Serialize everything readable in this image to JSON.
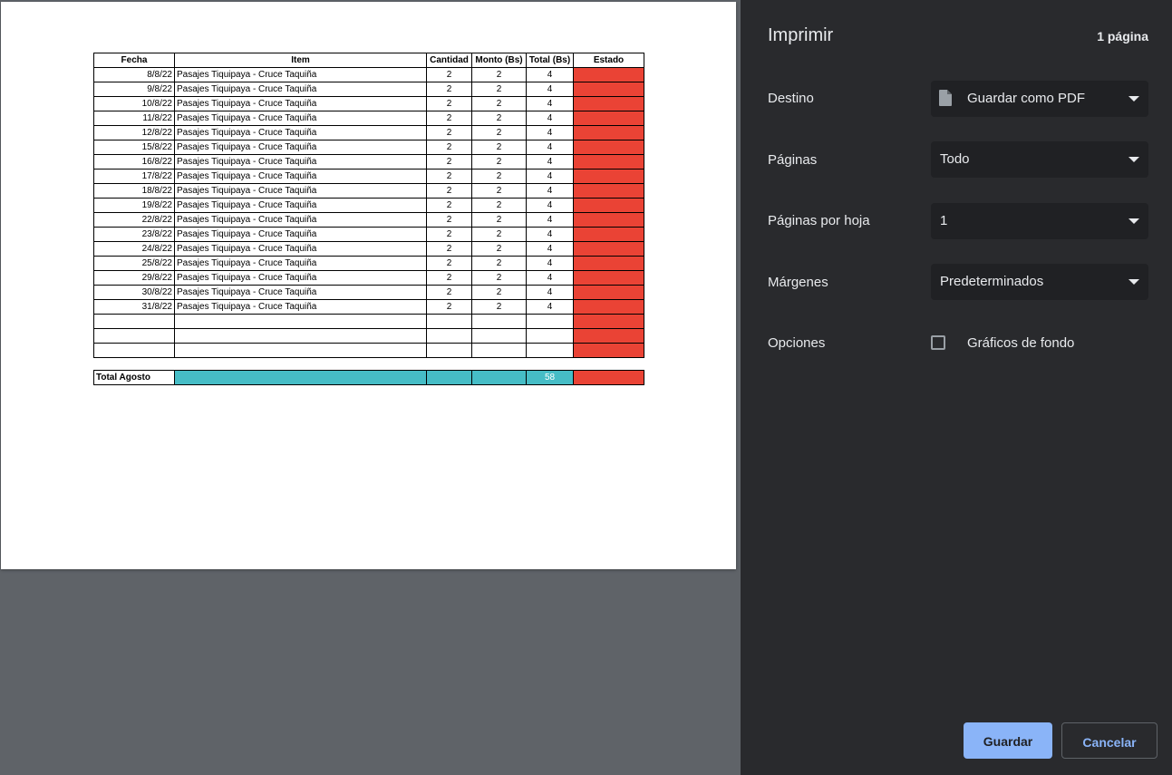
{
  "sheet": {
    "headers": [
      "Fecha",
      "Item",
      "Cantidad",
      "Monto (Bs)",
      "Total (Bs)",
      "Estado"
    ],
    "rows": [
      {
        "fecha": "8/8/22",
        "item": "Pasajes Tiquipaya - Cruce Taquiña",
        "cantidad": "2",
        "monto": "2",
        "total": "4"
      },
      {
        "fecha": "9/8/22",
        "item": "Pasajes Tiquipaya - Cruce Taquiña",
        "cantidad": "2",
        "monto": "2",
        "total": "4"
      },
      {
        "fecha": "10/8/22",
        "item": "Pasajes Tiquipaya - Cruce Taquiña",
        "cantidad": "2",
        "monto": "2",
        "total": "4"
      },
      {
        "fecha": "11/8/22",
        "item": "Pasajes Tiquipaya - Cruce Taquiña",
        "cantidad": "2",
        "monto": "2",
        "total": "4"
      },
      {
        "fecha": "12/8/22",
        "item": "Pasajes Tiquipaya - Cruce Taquiña",
        "cantidad": "2",
        "monto": "2",
        "total": "4"
      },
      {
        "fecha": "15/8/22",
        "item": "Pasajes Tiquipaya - Cruce Taquiña",
        "cantidad": "2",
        "monto": "2",
        "total": "4"
      },
      {
        "fecha": "16/8/22",
        "item": "Pasajes Tiquipaya - Cruce Taquiña",
        "cantidad": "2",
        "monto": "2",
        "total": "4"
      },
      {
        "fecha": "17/8/22",
        "item": "Pasajes Tiquipaya - Cruce Taquiña",
        "cantidad": "2",
        "monto": "2",
        "total": "4"
      },
      {
        "fecha": "18/8/22",
        "item": "Pasajes Tiquipaya - Cruce Taquiña",
        "cantidad": "2",
        "monto": "2",
        "total": "4"
      },
      {
        "fecha": "19/8/22",
        "item": "Pasajes Tiquipaya - Cruce Taquiña",
        "cantidad": "2",
        "monto": "2",
        "total": "4"
      },
      {
        "fecha": "22/8/22",
        "item": "Pasajes Tiquipaya - Cruce Taquiña",
        "cantidad": "2",
        "monto": "2",
        "total": "4"
      },
      {
        "fecha": "23/8/22",
        "item": "Pasajes Tiquipaya - Cruce Taquiña",
        "cantidad": "2",
        "monto": "2",
        "total": "4"
      },
      {
        "fecha": "24/8/22",
        "item": "Pasajes Tiquipaya - Cruce Taquiña",
        "cantidad": "2",
        "monto": "2",
        "total": "4"
      },
      {
        "fecha": "25/8/22",
        "item": "Pasajes Tiquipaya - Cruce Taquiña",
        "cantidad": "2",
        "monto": "2",
        "total": "4"
      },
      {
        "fecha": "29/8/22",
        "item": "Pasajes Tiquipaya - Cruce Taquiña",
        "cantidad": "2",
        "monto": "2",
        "total": "4"
      },
      {
        "fecha": "30/8/22",
        "item": "Pasajes Tiquipaya - Cruce Taquiña",
        "cantidad": "2",
        "monto": "2",
        "total": "4"
      },
      {
        "fecha": "31/8/22",
        "item": "Pasajes Tiquipaya - Cruce Taquiña",
        "cantidad": "2",
        "monto": "2",
        "total": "4"
      },
      {
        "fecha": "",
        "item": "",
        "cantidad": "",
        "monto": "",
        "total": ""
      },
      {
        "fecha": "",
        "item": "",
        "cantidad": "",
        "monto": "",
        "total": ""
      },
      {
        "fecha": "",
        "item": "",
        "cantidad": "",
        "monto": "",
        "total": ""
      }
    ],
    "total_label": "Total Agosto",
    "total_value": "58",
    "estado_color": "#ea4335",
    "total_color": "#46bdc6"
  },
  "panel": {
    "title": "Imprimir",
    "page_count": "1 página",
    "destino_label": "Destino",
    "destino_value": "Guardar como PDF",
    "paginas_label": "Páginas",
    "paginas_value": "Todo",
    "por_hoja_label": "Páginas por hoja",
    "por_hoja_value": "1",
    "margenes_label": "Márgenes",
    "margenes_value": "Predeterminados",
    "opciones_label": "Opciones",
    "graficos_label": "Gráficos de fondo",
    "graficos_checked": false,
    "save_label": "Guardar",
    "cancel_label": "Cancelar",
    "accent_color": "#8ab4f8",
    "file_icon": "file-icon",
    "caret_icon": "caret-down-icon"
  }
}
